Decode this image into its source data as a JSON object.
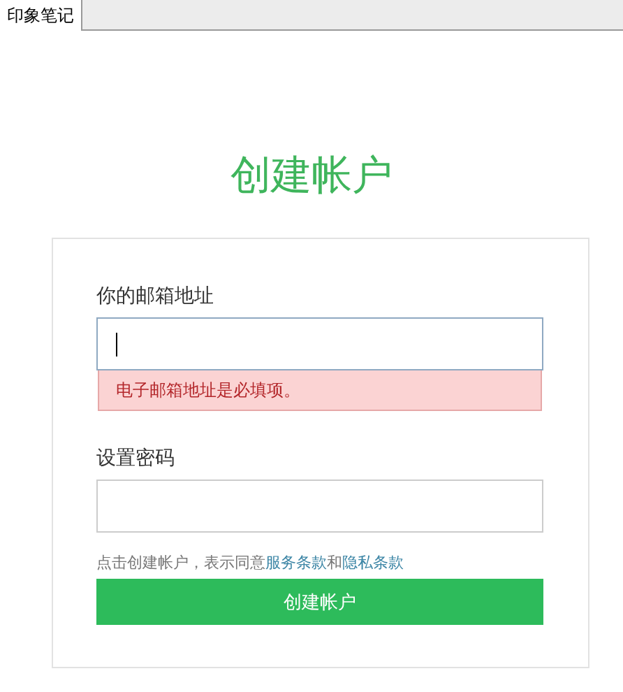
{
  "tabs": [
    {
      "label": "印象笔记",
      "selected": true
    }
  ],
  "title": "创建帐户",
  "fields": [
    {
      "label": "你的邮箱地址",
      "focused": true,
      "error": "电子邮箱地址是必填项。"
    },
    {
      "label": "设置密码",
      "focused": false
    }
  ],
  "legal": {
    "prefix": "点击创建帐户，表示同意",
    "link_1": "服务条款",
    "joiner": "和",
    "link_2": "隐私条款"
  },
  "submit": "创建帐户"
}
